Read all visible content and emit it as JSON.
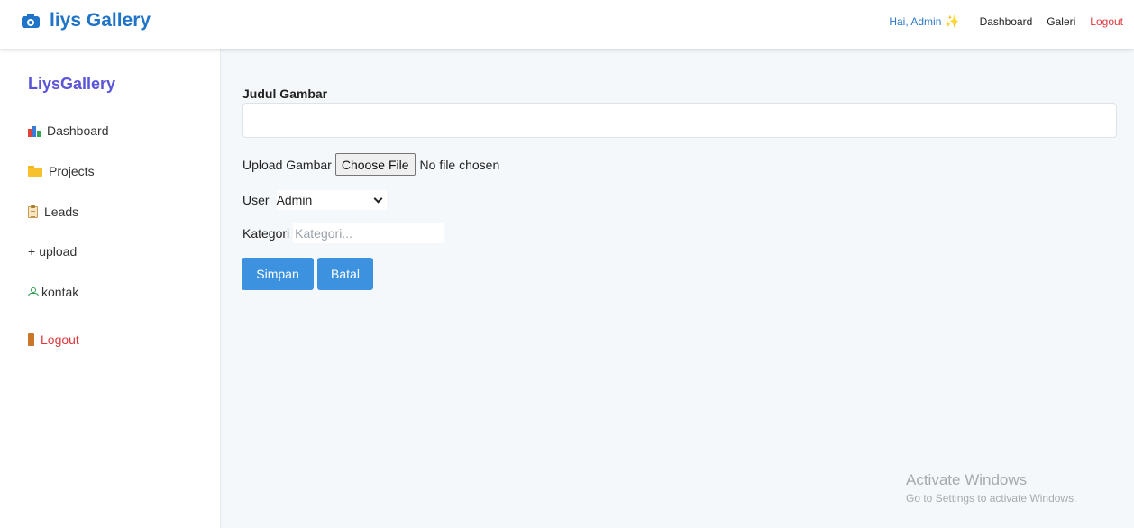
{
  "navbar": {
    "brand_title": "liys Gallery",
    "brand_icon": "camera-icon",
    "greeting": "Hai, Admin",
    "greeting_icon": "sparkle-icon",
    "links": [
      "Dashboard",
      "Galeri",
      "Logout"
    ]
  },
  "sidebar": {
    "brand": "LiysGallery",
    "items": [
      {
        "label": "Dashboard",
        "icon": "bar-chart-icon"
      },
      {
        "label": "Projects",
        "icon": "folder-icon"
      },
      {
        "label": "Leads",
        "icon": "clipboard-icon"
      },
      {
        "label": "upload",
        "icon": "plus-icon",
        "prefix": "+"
      },
      {
        "label": "kontak",
        "icon": "person-icon"
      },
      {
        "label": "Logout",
        "icon": "door-icon"
      }
    ]
  },
  "form": {
    "title_label": "Judul Gambar",
    "title_value": "",
    "upload_label": "Upload Gambar",
    "file_button": "Choose File",
    "file_status": "No file chosen",
    "user_label": "User",
    "user_selected": "Admin",
    "kategori_label": "Kategori",
    "kategori_placeholder": "Kategori...",
    "save_button": "Simpan",
    "cancel_button": "Batal"
  },
  "watermark": {
    "title": "Activate Windows",
    "subtitle": "Go to Settings to activate Windows."
  },
  "colors": {
    "brand_blue": "#1f73c8",
    "sidebar_brand": "#5a54d8",
    "logout_red": "#e0393e",
    "button_blue": "#3d92e0"
  }
}
